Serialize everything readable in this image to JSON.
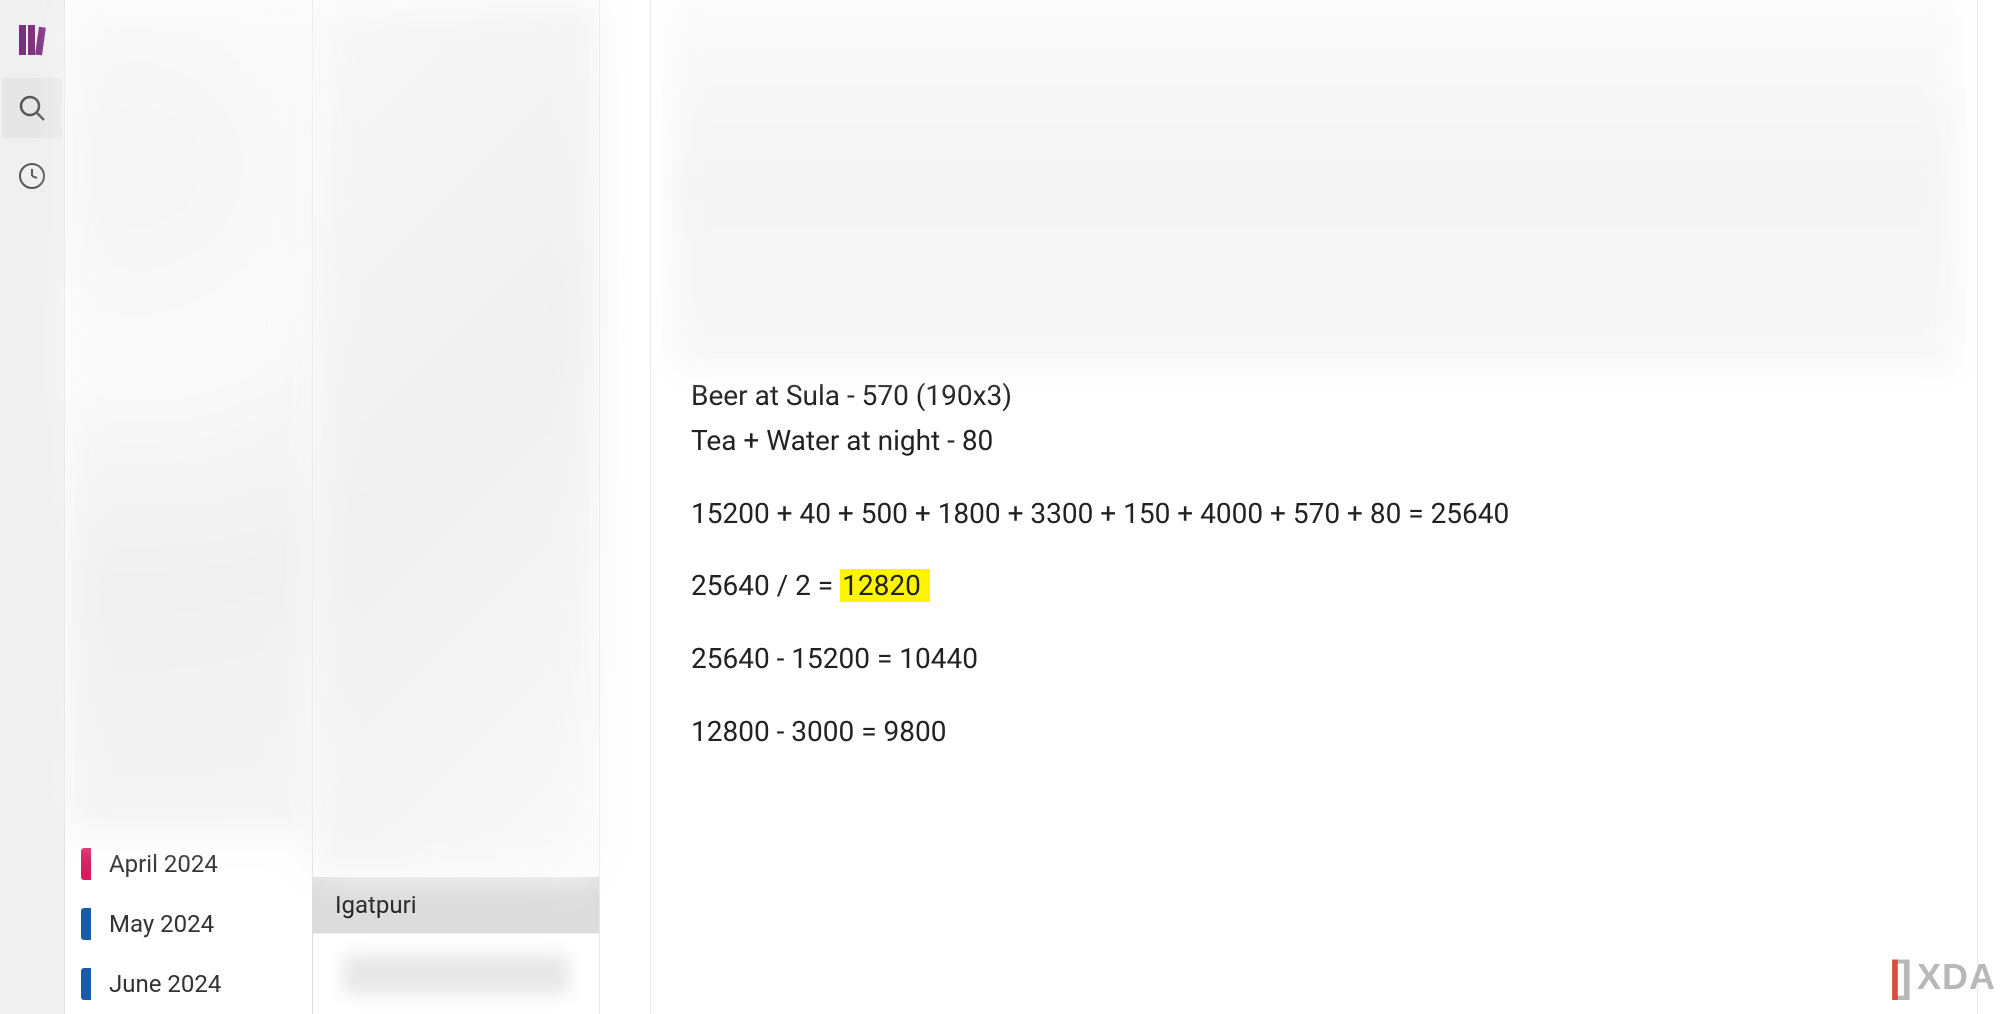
{
  "toolbar": {
    "notebooks_icon": "notebooks",
    "search_icon": "search",
    "recent_icon": "recent"
  },
  "notebooks": {
    "items": [
      {
        "label": "April 2024",
        "color": "pink"
      },
      {
        "label": "May 2024",
        "color": "blue"
      },
      {
        "label": "June 2024",
        "color": "blue"
      }
    ]
  },
  "pages": {
    "items": [
      {
        "label": "Igatpuri",
        "selected": true
      }
    ]
  },
  "note": {
    "lines": [
      "Beer at Sula - 570 (190x3)",
      "Tea + Water at night - 80",
      "",
      "15200 + 40 + 500 + 1800 + 3300 + 150 + 4000 + 570 + 80 = 25640",
      "",
      "",
      "25640 - 15200 = 10440",
      "",
      "12800 - 3000 = 9800"
    ],
    "calc_line_prefix": "25640 / 2 = ",
    "calc_highlight": "12820 "
  },
  "watermark": {
    "text": "XDA"
  }
}
